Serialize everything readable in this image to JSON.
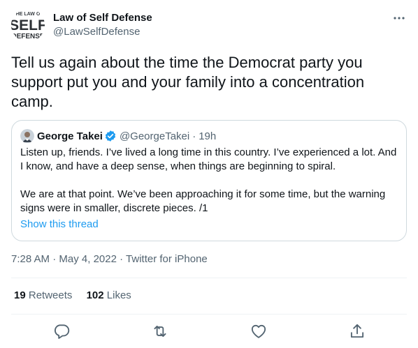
{
  "tweet": {
    "author_name": "Law of Self Defense",
    "author_handle": "@LawSelfDefense",
    "avatar_text_top": "HE LAW O",
    "avatar_text_main": "SELF",
    "avatar_text_bottom": "DEFENSE",
    "text": "Tell us again about the time the Democrat party you support put you and your family into a concentration camp.",
    "time": "7:28 AM",
    "date": "May 4, 2022",
    "source": "Twitter for iPhone",
    "separator": "·"
  },
  "quote": {
    "name": "George Takei",
    "handle": "@GeorgeTakei",
    "separator": "·",
    "time": "19h",
    "paragraph1": "Listen up, friends. I’ve lived a long time in this country. I’ve experienced a lot. And I know, and have a deep sense, when things are beginning to spiral.",
    "paragraph2": "We are at that point. We’ve been approaching it for some time, but the warning signs were in smaller, discrete pieces. /1",
    "show_thread": "Show this thread"
  },
  "stats": {
    "retweets_count": "19",
    "retweets_label": "Retweets",
    "likes_count": "102",
    "likes_label": "Likes"
  },
  "icons": {
    "more": "more-horizontal-icon",
    "reply": "reply-icon",
    "retweet": "retweet-icon",
    "like": "heart-icon",
    "share": "share-icon",
    "verified": "verified-badge-icon"
  },
  "colors": {
    "text": "#0f1419",
    "secondary": "#536471",
    "link": "#1d9bf0",
    "border": "#cfd9de",
    "divider": "#eff3f4"
  }
}
